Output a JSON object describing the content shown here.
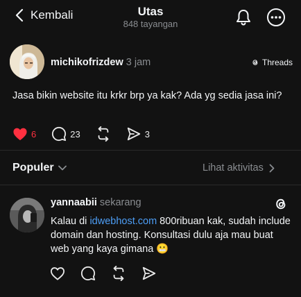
{
  "header": {
    "back_label": "Kembali",
    "title": "Utas",
    "views": "848 tayangan"
  },
  "post": {
    "username": "michikofrizdew",
    "time": "3 jam",
    "source": "Threads",
    "text": "Jasa bikin website itu krkr brp ya kak? Ada yg sedia jasa ini?",
    "likes": "6",
    "replies": "23",
    "shares": "3"
  },
  "replies_section": {
    "sort_label": "Populer",
    "activity_link": "Lihat aktivitas"
  },
  "reply": {
    "username": "yannaabii",
    "time": "sekarang",
    "text_before": "Kalau di ",
    "link": "idwebhost.com",
    "text_after": "  800ribuan kak, sudah include domain dan hosting. Konsultasi dulu aja mau buat web yang kaya gimana",
    "emoji": "😬"
  },
  "colors": {
    "background": "#121212",
    "like": "#ff3040",
    "link": "#4d9ef6",
    "muted": "#8a8d91"
  }
}
